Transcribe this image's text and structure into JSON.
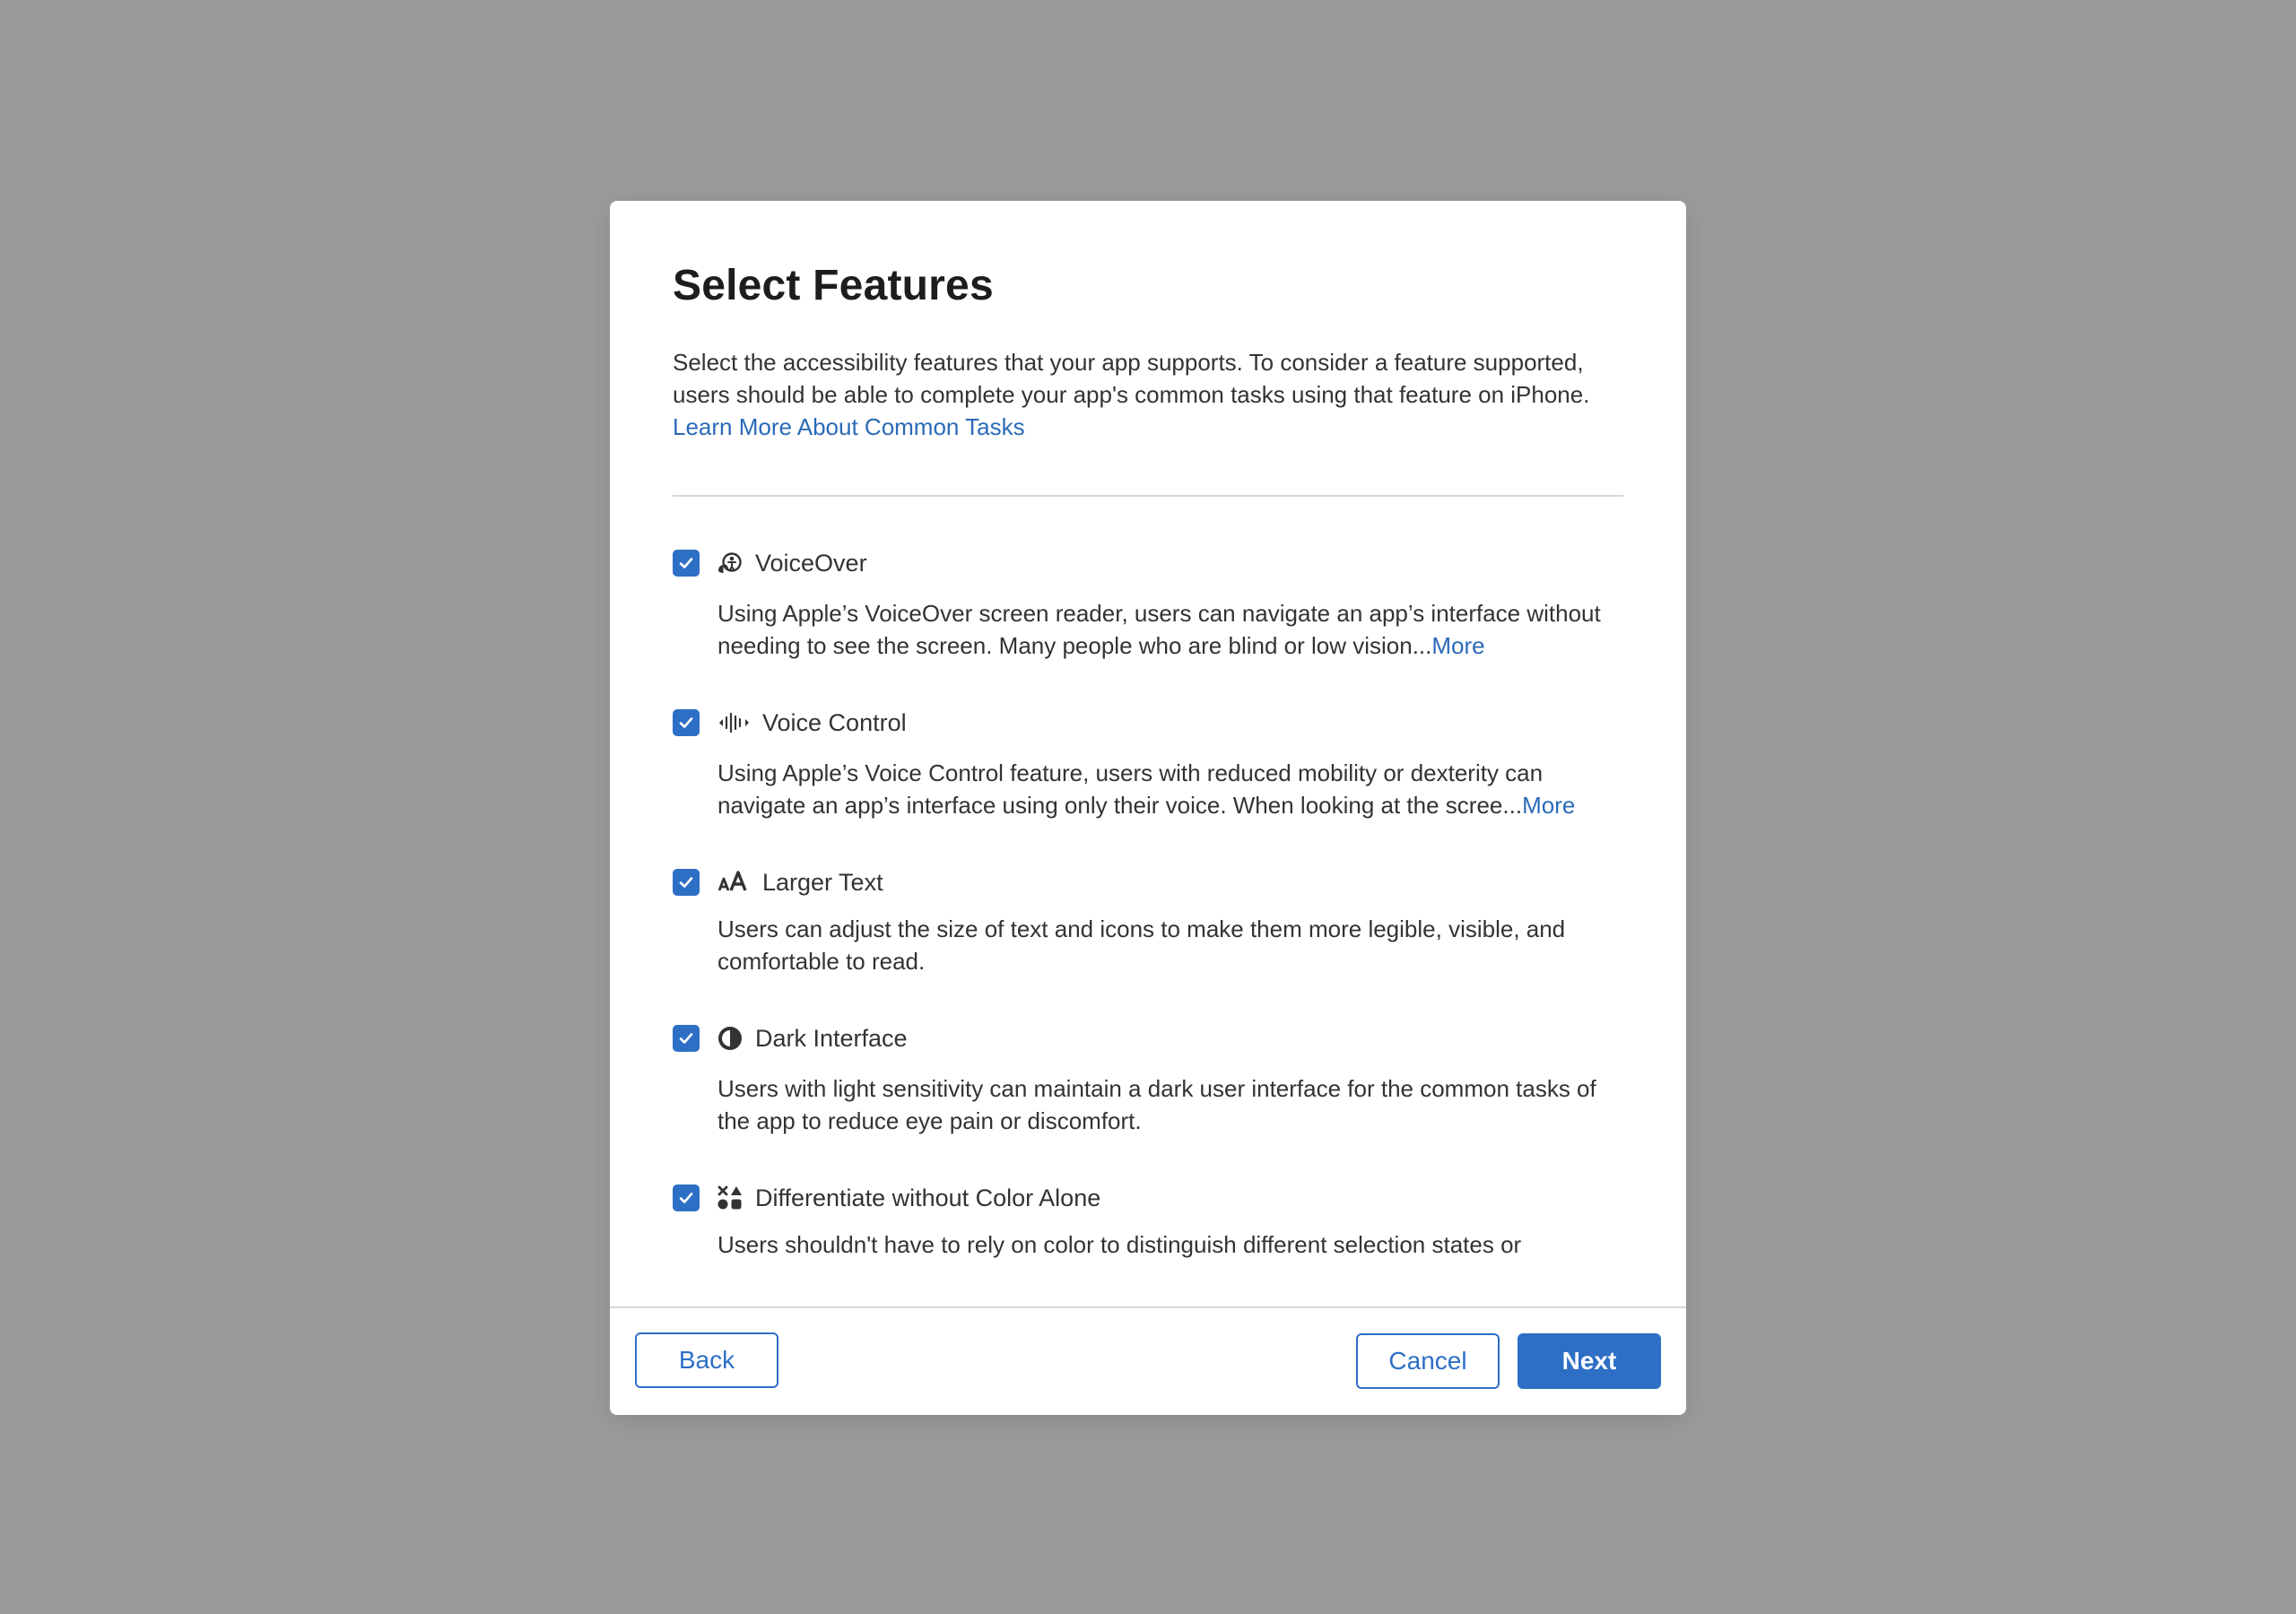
{
  "dialog": {
    "title": "Select Features",
    "intro_text": "Select the accessibility features that your app supports. To consider a feature supported, users should be able to complete your app's common tasks using that feature on iPhone.",
    "intro_link": "Learn More About Common Tasks"
  },
  "features": [
    {
      "label": "VoiceOver",
      "icon": "voiceover-icon",
      "checked": true,
      "description": "Using Apple’s VoiceOver screen reader, users can navigate an app’s interface without needing to see the screen. Many people who are blind or low vision...",
      "more": "More"
    },
    {
      "label": "Voice Control",
      "icon": "voice-control-icon",
      "checked": true,
      "description": "Using Apple’s Voice Control feature, users with reduced mobility or dexterity can navigate an app’s interface using only their voice. When looking at the scree...",
      "more": "More"
    },
    {
      "label": "Larger Text",
      "icon": "larger-text-icon",
      "checked": true,
      "description": "Users can adjust the size of text and icons to make them more legible, visible, and comfortable to read."
    },
    {
      "label": "Dark Interface",
      "icon": "dark-interface-icon",
      "checked": true,
      "description": "Users with light sensitivity can maintain a dark user interface for the common tasks of the app to reduce eye pain or discomfort."
    },
    {
      "label": "Differentiate without Color Alone",
      "icon": "differentiate-color-icon",
      "checked": true,
      "description": "Users shouldn't have to rely on color to distinguish different selection states or"
    }
  ],
  "footer": {
    "back_label": "Back",
    "cancel_label": "Cancel",
    "next_label": "Next"
  },
  "colors": {
    "accent": "#2e6fc6",
    "link": "#2b6ab8",
    "backdrop": "#9b9b9b",
    "text": "#333336"
  }
}
